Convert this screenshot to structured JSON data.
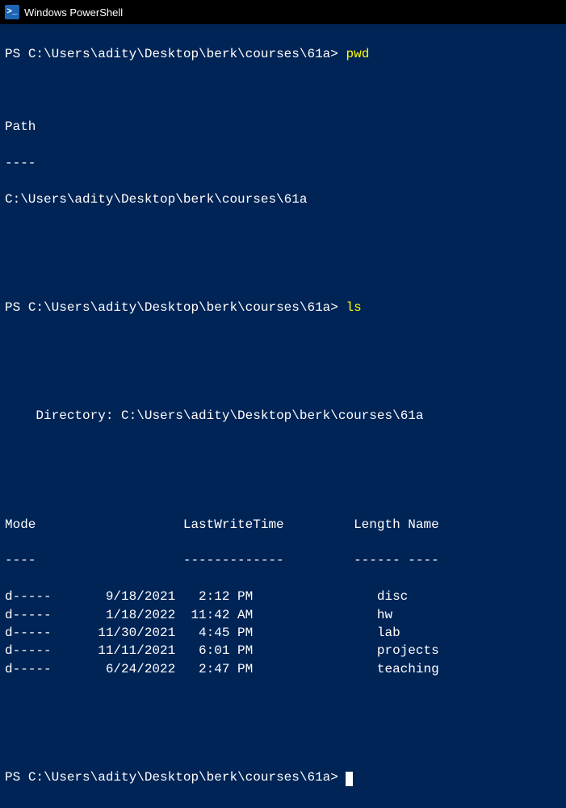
{
  "window": {
    "title": "Windows PowerShell",
    "icon_label": ">_"
  },
  "session": {
    "prompt_prefix": "PS ",
    "cwd": "C:\\Users\\adity\\Desktop\\berk\\courses\\61a",
    "prompt_suffix": "> ",
    "commands": {
      "cmd1": "pwd",
      "cmd2": "ls",
      "cmd3": ""
    },
    "pwd_output": {
      "header": "Path",
      "divider": "----",
      "value": "C:\\Users\\adity\\Desktop\\berk\\courses\\61a"
    },
    "ls_output": {
      "dir_label": "    Directory: ",
      "dir_path": "C:\\Users\\adity\\Desktop\\berk\\courses\\61a",
      "headers": {
        "mode": "Mode",
        "lwt": "LastWriteTime",
        "length": "Length",
        "name": "Name"
      },
      "dividers": {
        "mode": "----",
        "lwt": "-------------",
        "length": "------",
        "name": "----"
      },
      "rows": [
        {
          "mode": "d-----",
          "date": "9/18/2021",
          "time": "2:12 PM",
          "length": "",
          "name": "disc"
        },
        {
          "mode": "d-----",
          "date": "1/18/2022",
          "time": "11:42 AM",
          "length": "",
          "name": "hw"
        },
        {
          "mode": "d-----",
          "date": "11/30/2021",
          "time": "4:45 PM",
          "length": "",
          "name": "lab"
        },
        {
          "mode": "d-----",
          "date": "11/11/2021",
          "time": "6:01 PM",
          "length": "",
          "name": "projects"
        },
        {
          "mode": "d-----",
          "date": "6/24/2022",
          "time": "2:47 PM",
          "length": "",
          "name": "teaching"
        }
      ]
    }
  }
}
